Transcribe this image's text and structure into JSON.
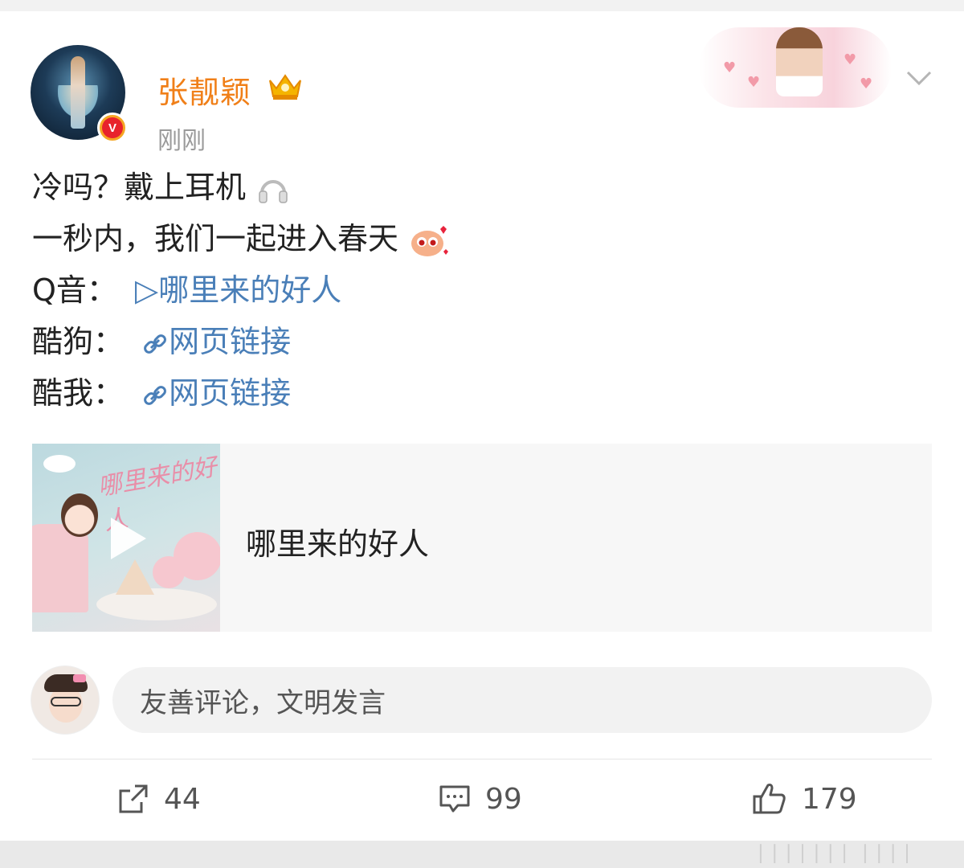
{
  "post": {
    "author": "张靓颖",
    "time": "刚刚",
    "verified_badge": "V",
    "lines": {
      "line1": "冷吗？戴上耳机",
      "line2": "一秒内，我们一起进入春天",
      "line3_prefix": "Q音：",
      "line3_link": "哪里来的好人",
      "line4_prefix": "酷狗：",
      "line4_link": "网页链接",
      "line5_prefix": "酷我：",
      "line5_link": "网页链接"
    },
    "music_card": {
      "title": "哪里来的好人",
      "cover_script": "哪里来的好人"
    }
  },
  "comment": {
    "placeholder": "友善评论，文明发言"
  },
  "actions": {
    "repost_count": "44",
    "comment_count": "99",
    "like_count": "179"
  },
  "colors": {
    "username": "#f07f18",
    "link": "#4a7fb8",
    "verified": "#e8232c"
  },
  "icons": {
    "repost": "share-icon",
    "comment": "comment-icon",
    "like": "thumbs-up-icon",
    "more": "chevron-down-icon",
    "headphones": "headphones-icon",
    "emoji": "cute-emoji-icon"
  }
}
